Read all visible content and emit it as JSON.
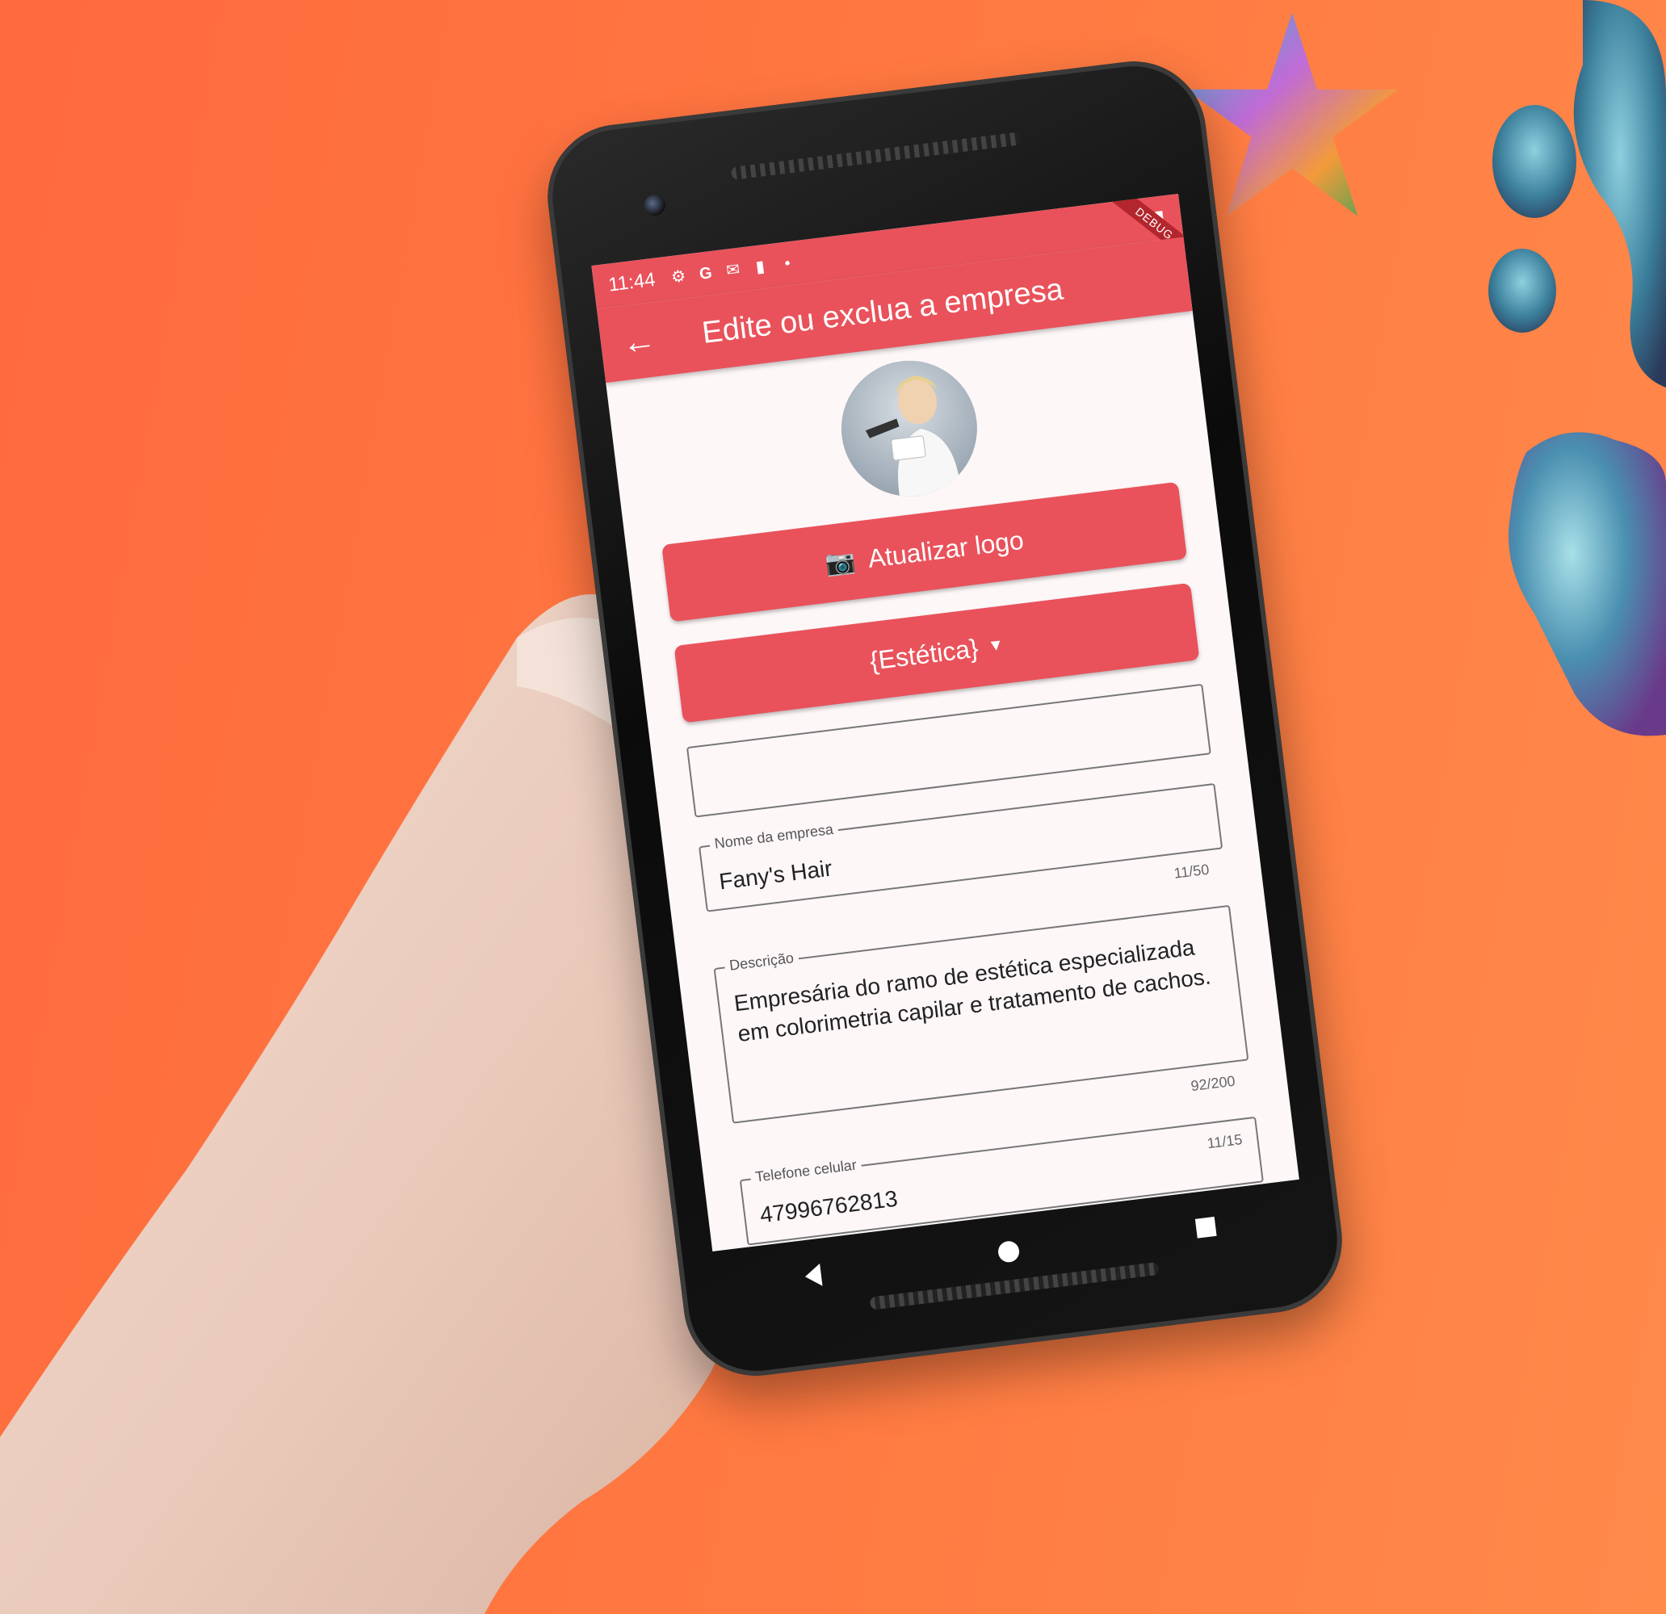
{
  "status_bar": {
    "time": "11:44",
    "icons": [
      "gear-icon",
      "google-icon",
      "gmail-icon",
      "sim-icon",
      "dot-icon"
    ],
    "debug_banner": "DEBUG"
  },
  "app_bar": {
    "back_icon": "arrow-left-icon",
    "title": "Edite ou exclua a empresa"
  },
  "buttons": {
    "update_logo": "Atualizar logo",
    "category": "{Estética}"
  },
  "fields": {
    "company_name": {
      "label": "Nome da empresa",
      "value": "Fany's Hair",
      "counter": "11/50"
    },
    "description": {
      "label": "Descrição",
      "value": "Empresária do ramo de estética especializada em colorimetria capilar e tratamento de cachos.",
      "counter": "92/200"
    },
    "phone": {
      "label": "Telefone celular",
      "value": "47996762813",
      "counter": "11/15"
    }
  },
  "colors": {
    "accent": "#e9525b",
    "background": "#ff7a42"
  }
}
